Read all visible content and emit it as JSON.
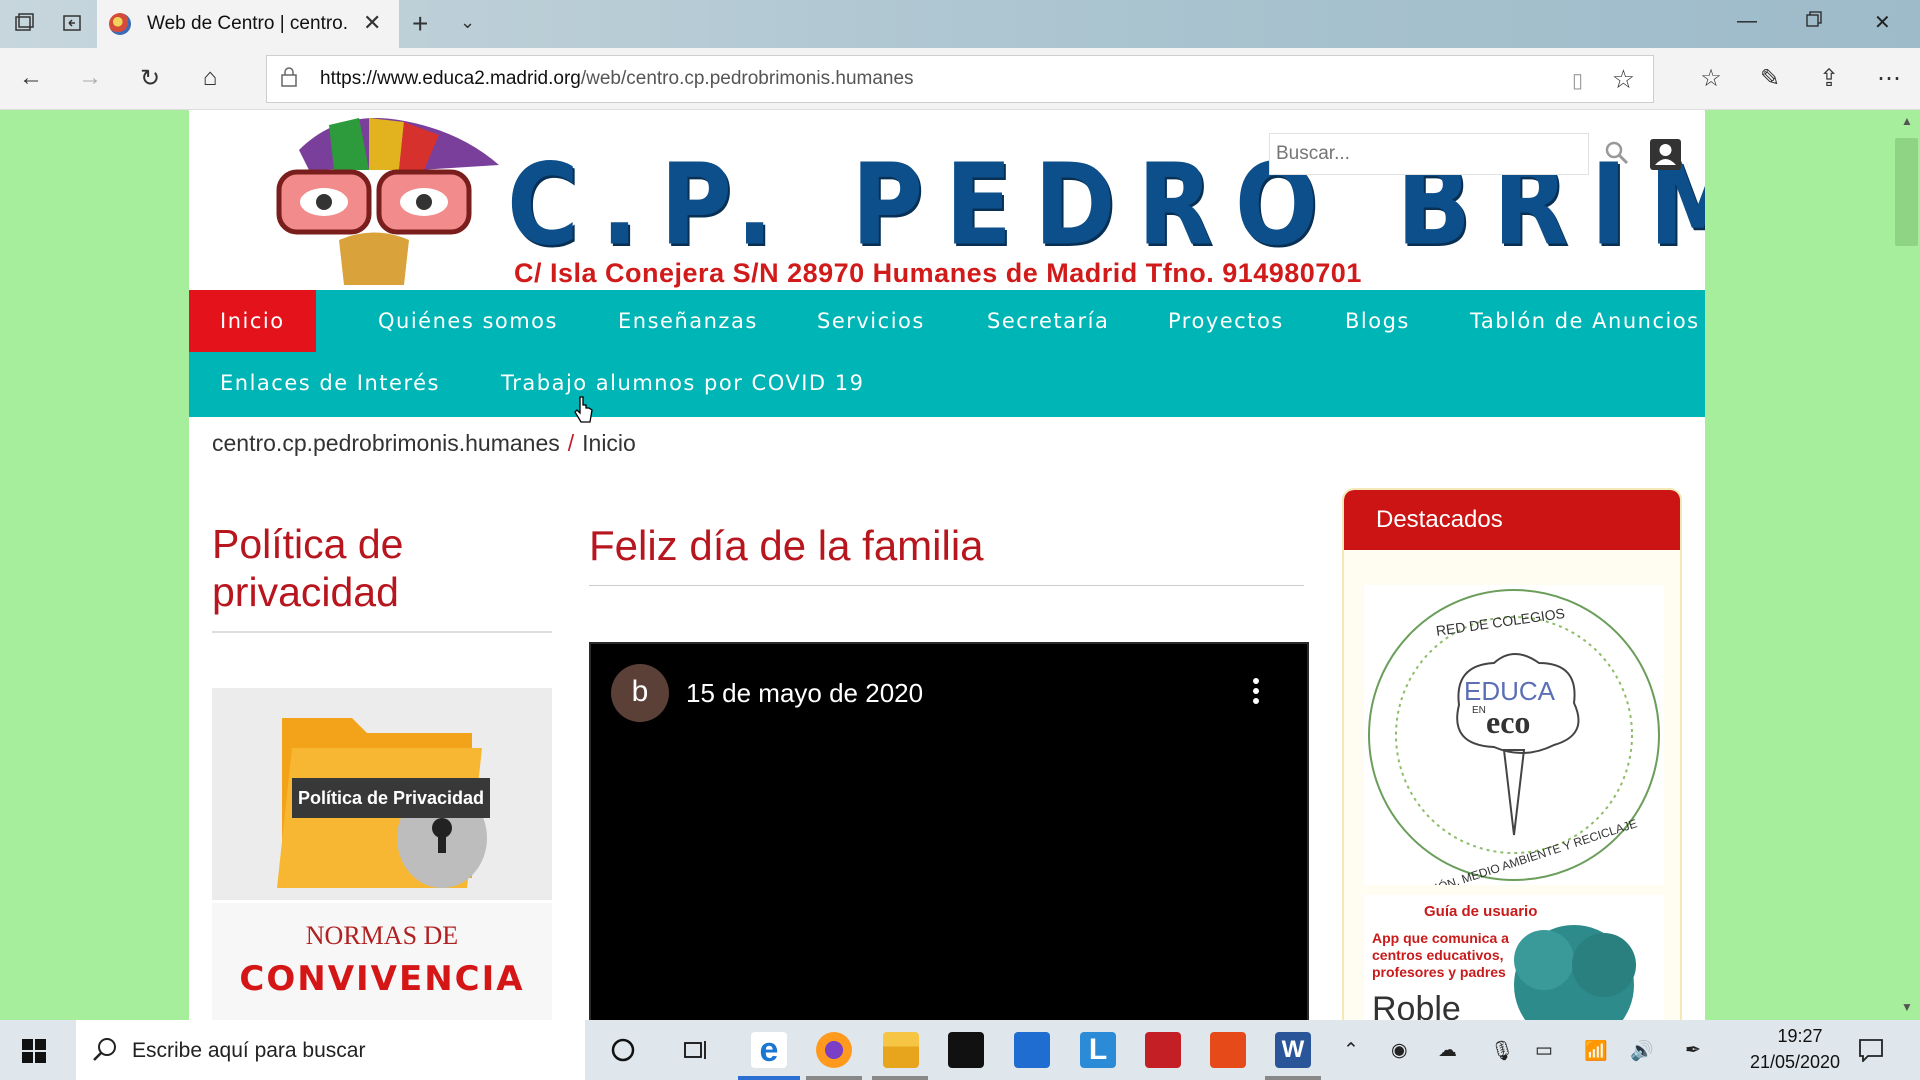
{
  "browser": {
    "tab_title": "Web de Centro | centro.",
    "url_domain": "https://www.educa2.madrid.org",
    "url_path": "/web/centro.cp.pedrobrimonis.humanes"
  },
  "header": {
    "site_name": "C.P. PEDRO BRIMONIS",
    "address": "C/ Isla Conejera S/N    28970  Humanes de Madrid  Tfno. 914980701",
    "search_placeholder": "Buscar..."
  },
  "menu": {
    "items": [
      {
        "label": "Inicio"
      },
      {
        "label": "Quiénes somos"
      },
      {
        "label": "Enseñanzas"
      },
      {
        "label": "Servicios"
      },
      {
        "label": "Secretaría"
      },
      {
        "label": "Proyectos"
      },
      {
        "label": "Blogs"
      },
      {
        "label": "Tablón de Anuncios"
      },
      {
        "label": "Enlaces de Interés"
      },
      {
        "label": "Trabajo alumnos por COVID 19"
      }
    ]
  },
  "breadcrumb": {
    "root": "centro.cp.pedrobrimonis.humanes",
    "separator": "/",
    "current": "Inicio"
  },
  "left": {
    "title": "Política de privacidad",
    "privacy_label": "Política de Privacidad",
    "normas_title": "NORMAS DE",
    "normas_word": "CONVIVENCIA"
  },
  "article": {
    "title": "Feliz día de la familia",
    "video": {
      "avatar_letter": "b",
      "title": "15 de mayo de 2020"
    }
  },
  "destacados": {
    "title": "Destacados",
    "eco_logo": {
      "top_text": "RED DE COLEGIOS",
      "brand_top": "EDUCA",
      "brand_en": "EN",
      "brand_bottom": "eco",
      "bottom_text": "EDUCACIÓN, MEDIO AMBIENTE Y RECICLAJE"
    },
    "guia": {
      "title": "Guía de usuario",
      "text": "App que comunica a centros educativos, profesores y padres",
      "brand": "Roble"
    }
  },
  "taskbar": {
    "search_text": "Escribe aquí para buscar",
    "time": "19:27",
    "date": "21/05/2020"
  },
  "colors": {
    "menu_bg": "#00b5b5",
    "menu_active": "#e3121b",
    "title_red": "#b8161e",
    "site_blue": "#0d4f8a",
    "page_bg": "#a6ee9c"
  }
}
